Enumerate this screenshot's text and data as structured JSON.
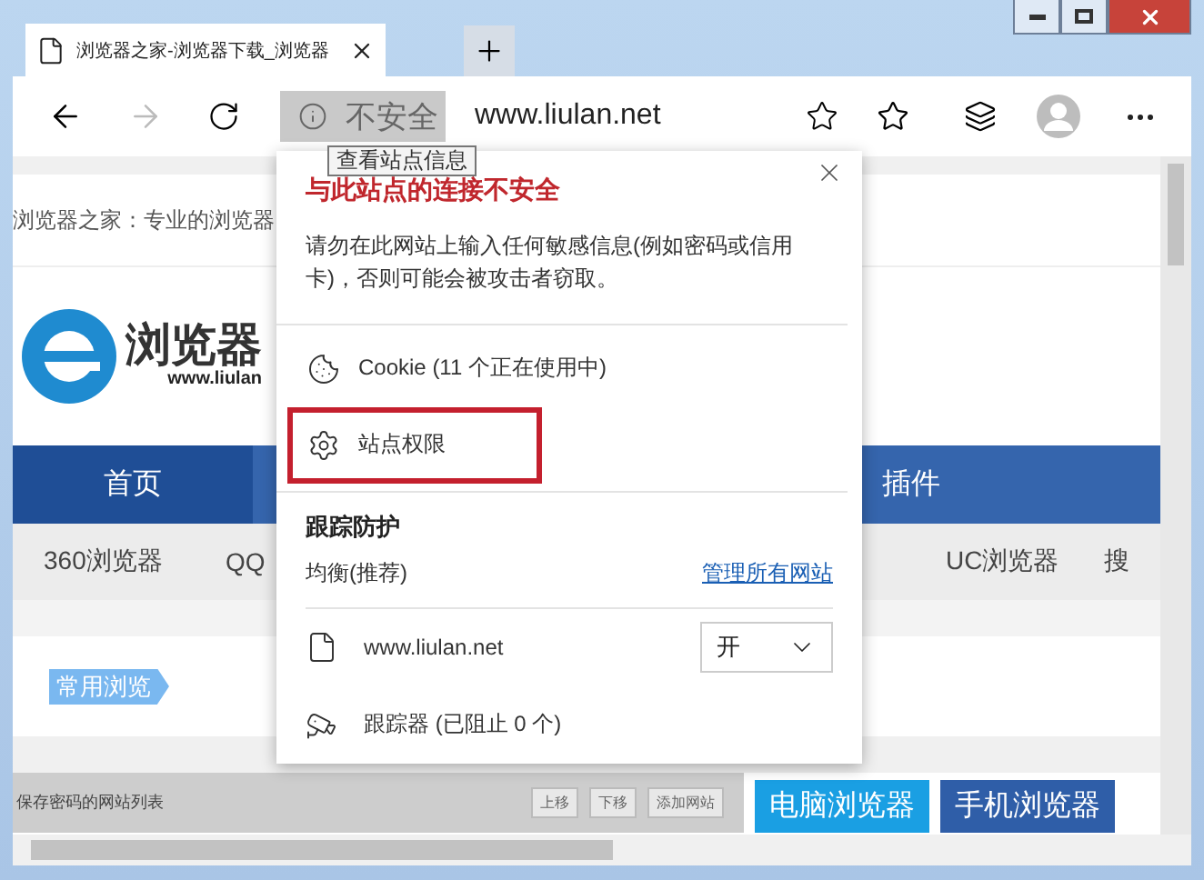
{
  "tabs": [
    {
      "title": "浏览器之家-浏览器下载_浏览器",
      "selected": true
    }
  ],
  "address_bar": {
    "security_label": "不安全",
    "url": "www.liulan.net"
  },
  "tooltip": "查看站点信息",
  "page": {
    "tagline": "浏览器之家：专业的浏览器",
    "logo_text": "浏览器",
    "logo_url": "www.liulan",
    "nav": [
      {
        "label": "首页",
        "selected": true
      },
      {
        "label": "插件",
        "selected": false
      }
    ],
    "subnav": [
      "360浏览器",
      "QQ",
      "UC浏览器",
      "搜"
    ],
    "section_tag": "常用浏览",
    "saved_list_label": "保存密码的网站列表",
    "small_buttons": [
      "上移",
      "下移",
      "添加网站"
    ],
    "category_buttons": [
      {
        "label": "电脑浏览器",
        "color": "#1a9fe3"
      },
      {
        "label": "手机浏览器",
        "color": "#2f5ea8"
      }
    ]
  },
  "site_info": {
    "title": "与此站点的连接不安全",
    "warning": "请勿在此网站上输入任何敏感信息(例如密码或信用卡)，否则可能会被攻击者窃取。",
    "items": [
      {
        "kind": "cookies",
        "label": "Cookie (11 个正在使用中)",
        "highlighted": false
      },
      {
        "kind": "permissions",
        "label": "站点权限",
        "highlighted": true
      }
    ],
    "tracking": {
      "heading": "跟踪防护",
      "mode": "均衡(推荐)",
      "manage_link": "管理所有网站",
      "site": "www.liulan.net",
      "setting": "开",
      "trackers": "跟踪器 (已阻止 0 个)"
    }
  }
}
